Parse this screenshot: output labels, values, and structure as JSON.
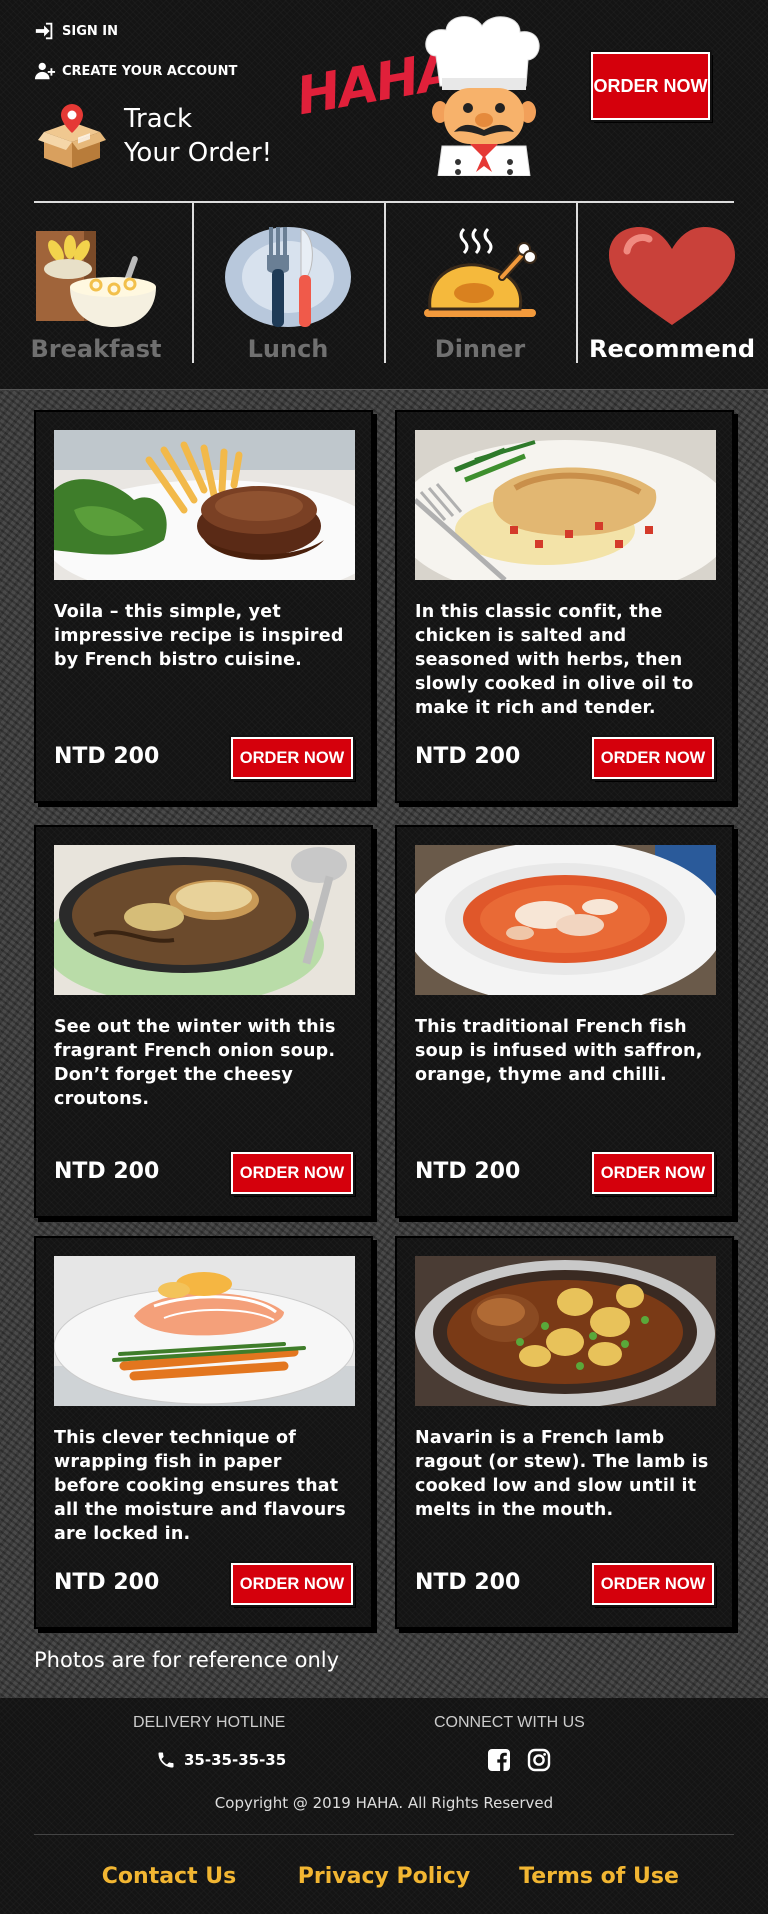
{
  "header": {
    "sign_in": "SIGN IN",
    "create_account": "CREATE YOUR ACCOUNT",
    "track_line1": "Track",
    "track_line2": "Your Order!",
    "logo_text": "HAHA!",
    "order_now": "ORDER NOW"
  },
  "categories": [
    {
      "label": "Breakfast",
      "icon": "cereal-bowl-icon",
      "active": false
    },
    {
      "label": "Lunch",
      "icon": "plate-fork-knife-icon",
      "active": false
    },
    {
      "label": "Dinner",
      "icon": "roast-chicken-icon",
      "active": false
    },
    {
      "label": "Recommend",
      "icon": "heart-icon",
      "active": true
    }
  ],
  "menu": [
    {
      "desc": "Voila – this simple, yet impressive recipe is inspired by French bistro cuisine.",
      "price": "NTD 200",
      "button": "ORDER NOW",
      "photo": "steak-with-fries"
    },
    {
      "desc": "In this classic confit, the chicken is salted and seasoned with herbs, then slowly cooked in olive oil to make it rich and tender.",
      "price": "NTD 200",
      "button": "ORDER NOW",
      "photo": "chicken-confit"
    },
    {
      "desc": "See out the winter with this fragrant French onion soup. Don’t forget the cheesy croutons.",
      "price": "NTD 200",
      "button": "ORDER NOW",
      "photo": "onion-soup"
    },
    {
      "desc": "This traditional French fish soup is infused with saffron, orange, thyme and chilli.",
      "price": "NTD 200",
      "button": "ORDER NOW",
      "photo": "fish-soup"
    },
    {
      "desc": "This clever technique of wrapping fish in paper before cooking ensures that all the moisture and flavours are locked in.",
      "price": "NTD 200",
      "button": "ORDER NOW",
      "photo": "salmon-en-papillote"
    },
    {
      "desc": "Navarin is a French lamb ragout (or stew). The lamb is cooked low and slow until it melts in the mouth.",
      "price": "NTD 200",
      "button": "ORDER NOW",
      "photo": "lamb-navarin"
    }
  ],
  "note": "Photos are for reference only",
  "footer": {
    "hotline_heading": "DELIVERY HOTLINE",
    "hotline_number": "35-35-35-35",
    "connect_heading": "CONNECT WITH US",
    "copyright": "Copyright @ 2019 HAHA. All Rights Reserved",
    "links": [
      "Contact Us",
      "Privacy Policy",
      "Terms of Use"
    ]
  },
  "colors": {
    "accent_red": "#d5000c",
    "link_yellow": "#f2b632",
    "inactive_gray": "#707070"
  }
}
